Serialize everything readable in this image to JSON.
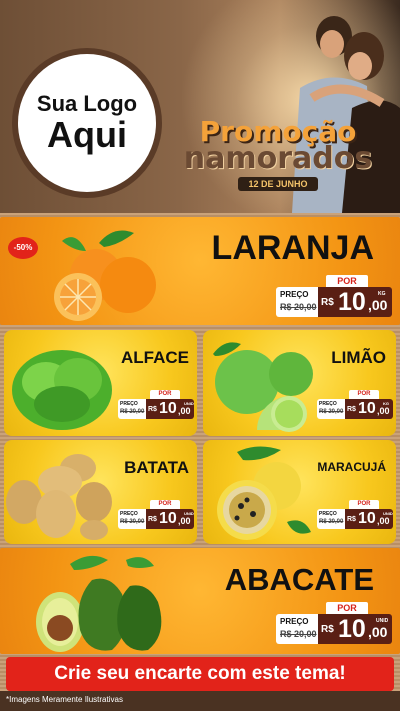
{
  "logo": {
    "line1": "Sua Logo",
    "line2": "Aqui"
  },
  "promo": {
    "title_line1": "Promoção",
    "title_line2": "namorados",
    "date": "12 DE JUNHO"
  },
  "products": [
    {
      "name": "LARANJA",
      "badge": "-50%",
      "por_label": "POR",
      "preco_label": "PREÇO",
      "old_price": "R$ 20,00",
      "currency": "R$",
      "price_int": "10",
      "price_dec": ",00",
      "unit": "KG"
    },
    {
      "name": "ALFACE",
      "por_label": "POR",
      "preco_label": "PREÇO",
      "old_price": "R$ 20,00",
      "currency": "R$",
      "price_int": "10",
      "price_dec": ",00",
      "unit": "UNID"
    },
    {
      "name": "LIMÃO",
      "por_label": "POR",
      "preco_label": "PREÇO",
      "old_price": "R$ 20,00",
      "currency": "R$",
      "price_int": "10",
      "price_dec": ",00",
      "unit": "KG"
    },
    {
      "name": "BATATA",
      "por_label": "POR",
      "preco_label": "PREÇO",
      "old_price": "R$ 20,00",
      "currency": "R$",
      "price_int": "10",
      "price_dec": ",00",
      "unit": "UNID"
    },
    {
      "name": "MARACUJÁ",
      "por_label": "POR",
      "preco_label": "PREÇO",
      "old_price": "R$ 20,00",
      "currency": "R$",
      "price_int": "10",
      "price_dec": ",00",
      "unit": "UNID"
    },
    {
      "name": "ABACATE",
      "por_label": "POR",
      "preco_label": "PREÇO",
      "old_price": "R$ 20,00",
      "currency": "R$",
      "price_int": "10",
      "price_dec": ",00",
      "unit": "UNID"
    }
  ],
  "cta": "Crie seu encarte com este tema!",
  "footer_note": "*Imagens Meramente Ilustrativas",
  "colors": {
    "orange": "#f39413",
    "yellow": "#f8c81e",
    "red": "#e2231a",
    "price_bg": "#5a1f14",
    "burlap": "#c19a72"
  }
}
